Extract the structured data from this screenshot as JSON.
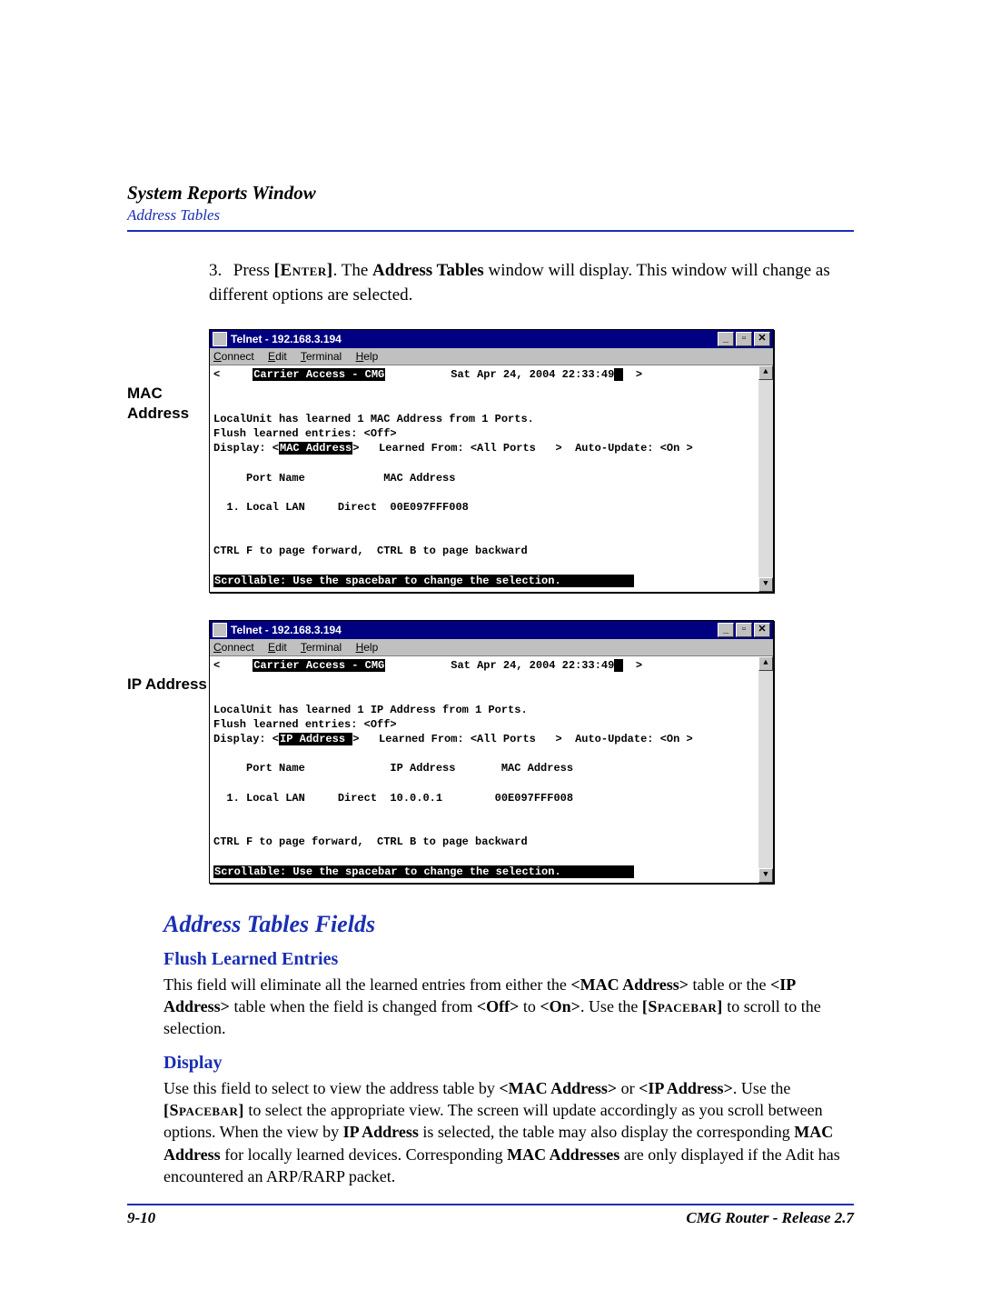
{
  "header": {
    "title": "System Reports Window",
    "subtitle": "Address Tables"
  },
  "step": {
    "number": "3.",
    "text_before_enter": "Press ",
    "enter_label": "[Enter]",
    "text_after_enter": ". The ",
    "bold1": "Address Tables",
    "text_mid": " window will display. This window will change as different options are selected."
  },
  "side_labels": {
    "mac": "MAC Address",
    "ip": "IP Address"
  },
  "telnet": {
    "title": "Telnet - 192.168.3.194",
    "menu": {
      "connect": "Connect",
      "edit": "Edit",
      "terminal": "Terminal",
      "help": "Help"
    },
    "win_btns": {
      "min": "_",
      "max": "▫",
      "close": "✕"
    },
    "scroll": {
      "up": "▲",
      "down": "▼"
    }
  },
  "term_mac": {
    "header_left": "<     ",
    "header_center": "Carrier Access - CMG",
    "header_right": "          Sat Apr 24, 2004 22:33:49",
    "arrow": "  > ",
    "line1": "LocalUnit has learned 1 MAC Address from 1 Ports.",
    "line2": "Flush learned entries: <Off>",
    "disp_pre": "Display: <",
    "disp_sel": "MAC Address",
    "disp_post": ">   Learned From: <All Ports   >  Auto-Update: <On >",
    "cols": "     Port Name            MAC Address",
    "row": "  1. Local LAN     Direct  00E097FFF008",
    "nav": "CTRL F to page forward,  CTRL B to page backward",
    "foot": "Scrollable: Use the spacebar to change the selection.           "
  },
  "term_ip": {
    "header_left": "<     ",
    "header_center": "Carrier Access - CMG",
    "header_right": "          Sat Apr 24, 2004 22:33:49",
    "arrow": "  > ",
    "line1": "LocalUnit has learned 1 IP Address from 1 Ports.",
    "line2": "Flush learned entries: <Off>",
    "disp_pre": "Display: <",
    "disp_sel": "IP Address ",
    "disp_post": ">   Learned From: <All Ports   >  Auto-Update: <On >",
    "cols": "     Port Name             IP Address       MAC Address",
    "row": "  1. Local LAN     Direct  10.0.0.1        00E097FFF008",
    "nav": "CTRL F to page forward,  CTRL B to page backward",
    "foot": "Scrollable: Use the spacebar to change the selection.           "
  },
  "section_heading": "Address Tables Fields",
  "flush": {
    "title": "Flush Learned Entries",
    "p1a": "This field will eliminate all the learned entries from either the ",
    "b1": "<MAC Address>",
    "p1b": " table or the ",
    "b2": "<IP Address>",
    "p1c": " table when the field is changed from ",
    "b3": "<Off>",
    "p1d": " to ",
    "b4": "<On>",
    "p1e": ". Use the ",
    "spacebar": "[Spacebar]",
    "p1f": " to scroll to the selection."
  },
  "display_sec": {
    "title": "Display",
    "p1": "Use this field to select to view the address table by ",
    "b1": "<MAC Address>",
    "p2": " or ",
    "b2": "<IP Address>",
    "p3": ". Use the ",
    "spacebar": "[Spacebar]",
    "p4": " to select the appropriate view. The screen will update accordingly as you scroll between options. When the view by ",
    "b3": "IP Address",
    "p5": " is selected, the table may also display the corresponding ",
    "b4": "MAC Address",
    "p6": " for locally learned devices. Corresponding ",
    "b5": "MAC Addresses",
    "p7": " are only displayed if the Adit has encountered an ARP/RARP packet."
  },
  "footer": {
    "page": "9-10",
    "product": "CMG Router - Release 2.7"
  }
}
